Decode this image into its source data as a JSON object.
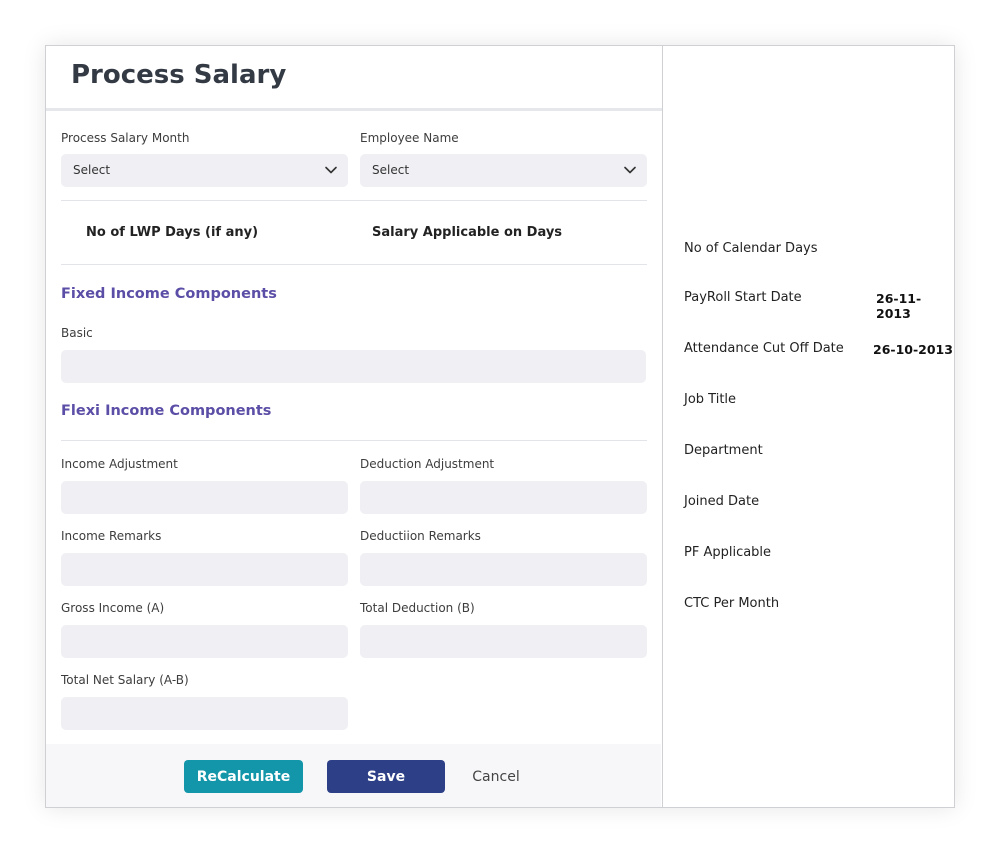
{
  "page": {
    "title": "Process Salary"
  },
  "filters": {
    "month_label": "Process Salary Month",
    "month_value": "Select",
    "employee_label": "Employee Name",
    "employee_value": "Select"
  },
  "days": {
    "lwp_label": "No of LWP Days (if any)",
    "applicable_label": "Salary Applicable on Days"
  },
  "fixed": {
    "heading": "Fixed Income Components",
    "basic_label": "Basic"
  },
  "flexi": {
    "heading": "Flexi Income Components",
    "income_adjustment_label": "Income Adjustment",
    "deduction_adjustment_label": "Deduction Adjustment",
    "income_remarks_label": "Income Remarks",
    "deduction_remarks_label": "Deductiion Remarks",
    "gross_income_label": "Gross Income (A)",
    "total_deduction_label": "Total Deduction (B)",
    "net_salary_label": "Total Net Salary (A-B)"
  },
  "actions": {
    "recalculate": "ReCalculate",
    "save": "Save",
    "cancel": "Cancel"
  },
  "info": {
    "calendar_days_label": "No of Calendar Days",
    "payroll_start_label": "PayRoll Start Date",
    "payroll_start_value": "26-11-2013",
    "attendance_cutoff_label": "Attendance Cut Off Date",
    "attendance_cutoff_value": "26-10-2013",
    "job_title_label": "Job Title",
    "department_label": "Department",
    "joined_date_label": "Joined Date",
    "pf_applicable_label": "PF Applicable",
    "ctc_label": "CTC Per Month"
  },
  "icons": {
    "select_chevron": "chevron-down-icon"
  },
  "colors": {
    "section_heading": "#5b4ea6",
    "recalculate_button": "#1396a9",
    "save_button": "#2c3f87",
    "input_background": "#efeff4"
  }
}
